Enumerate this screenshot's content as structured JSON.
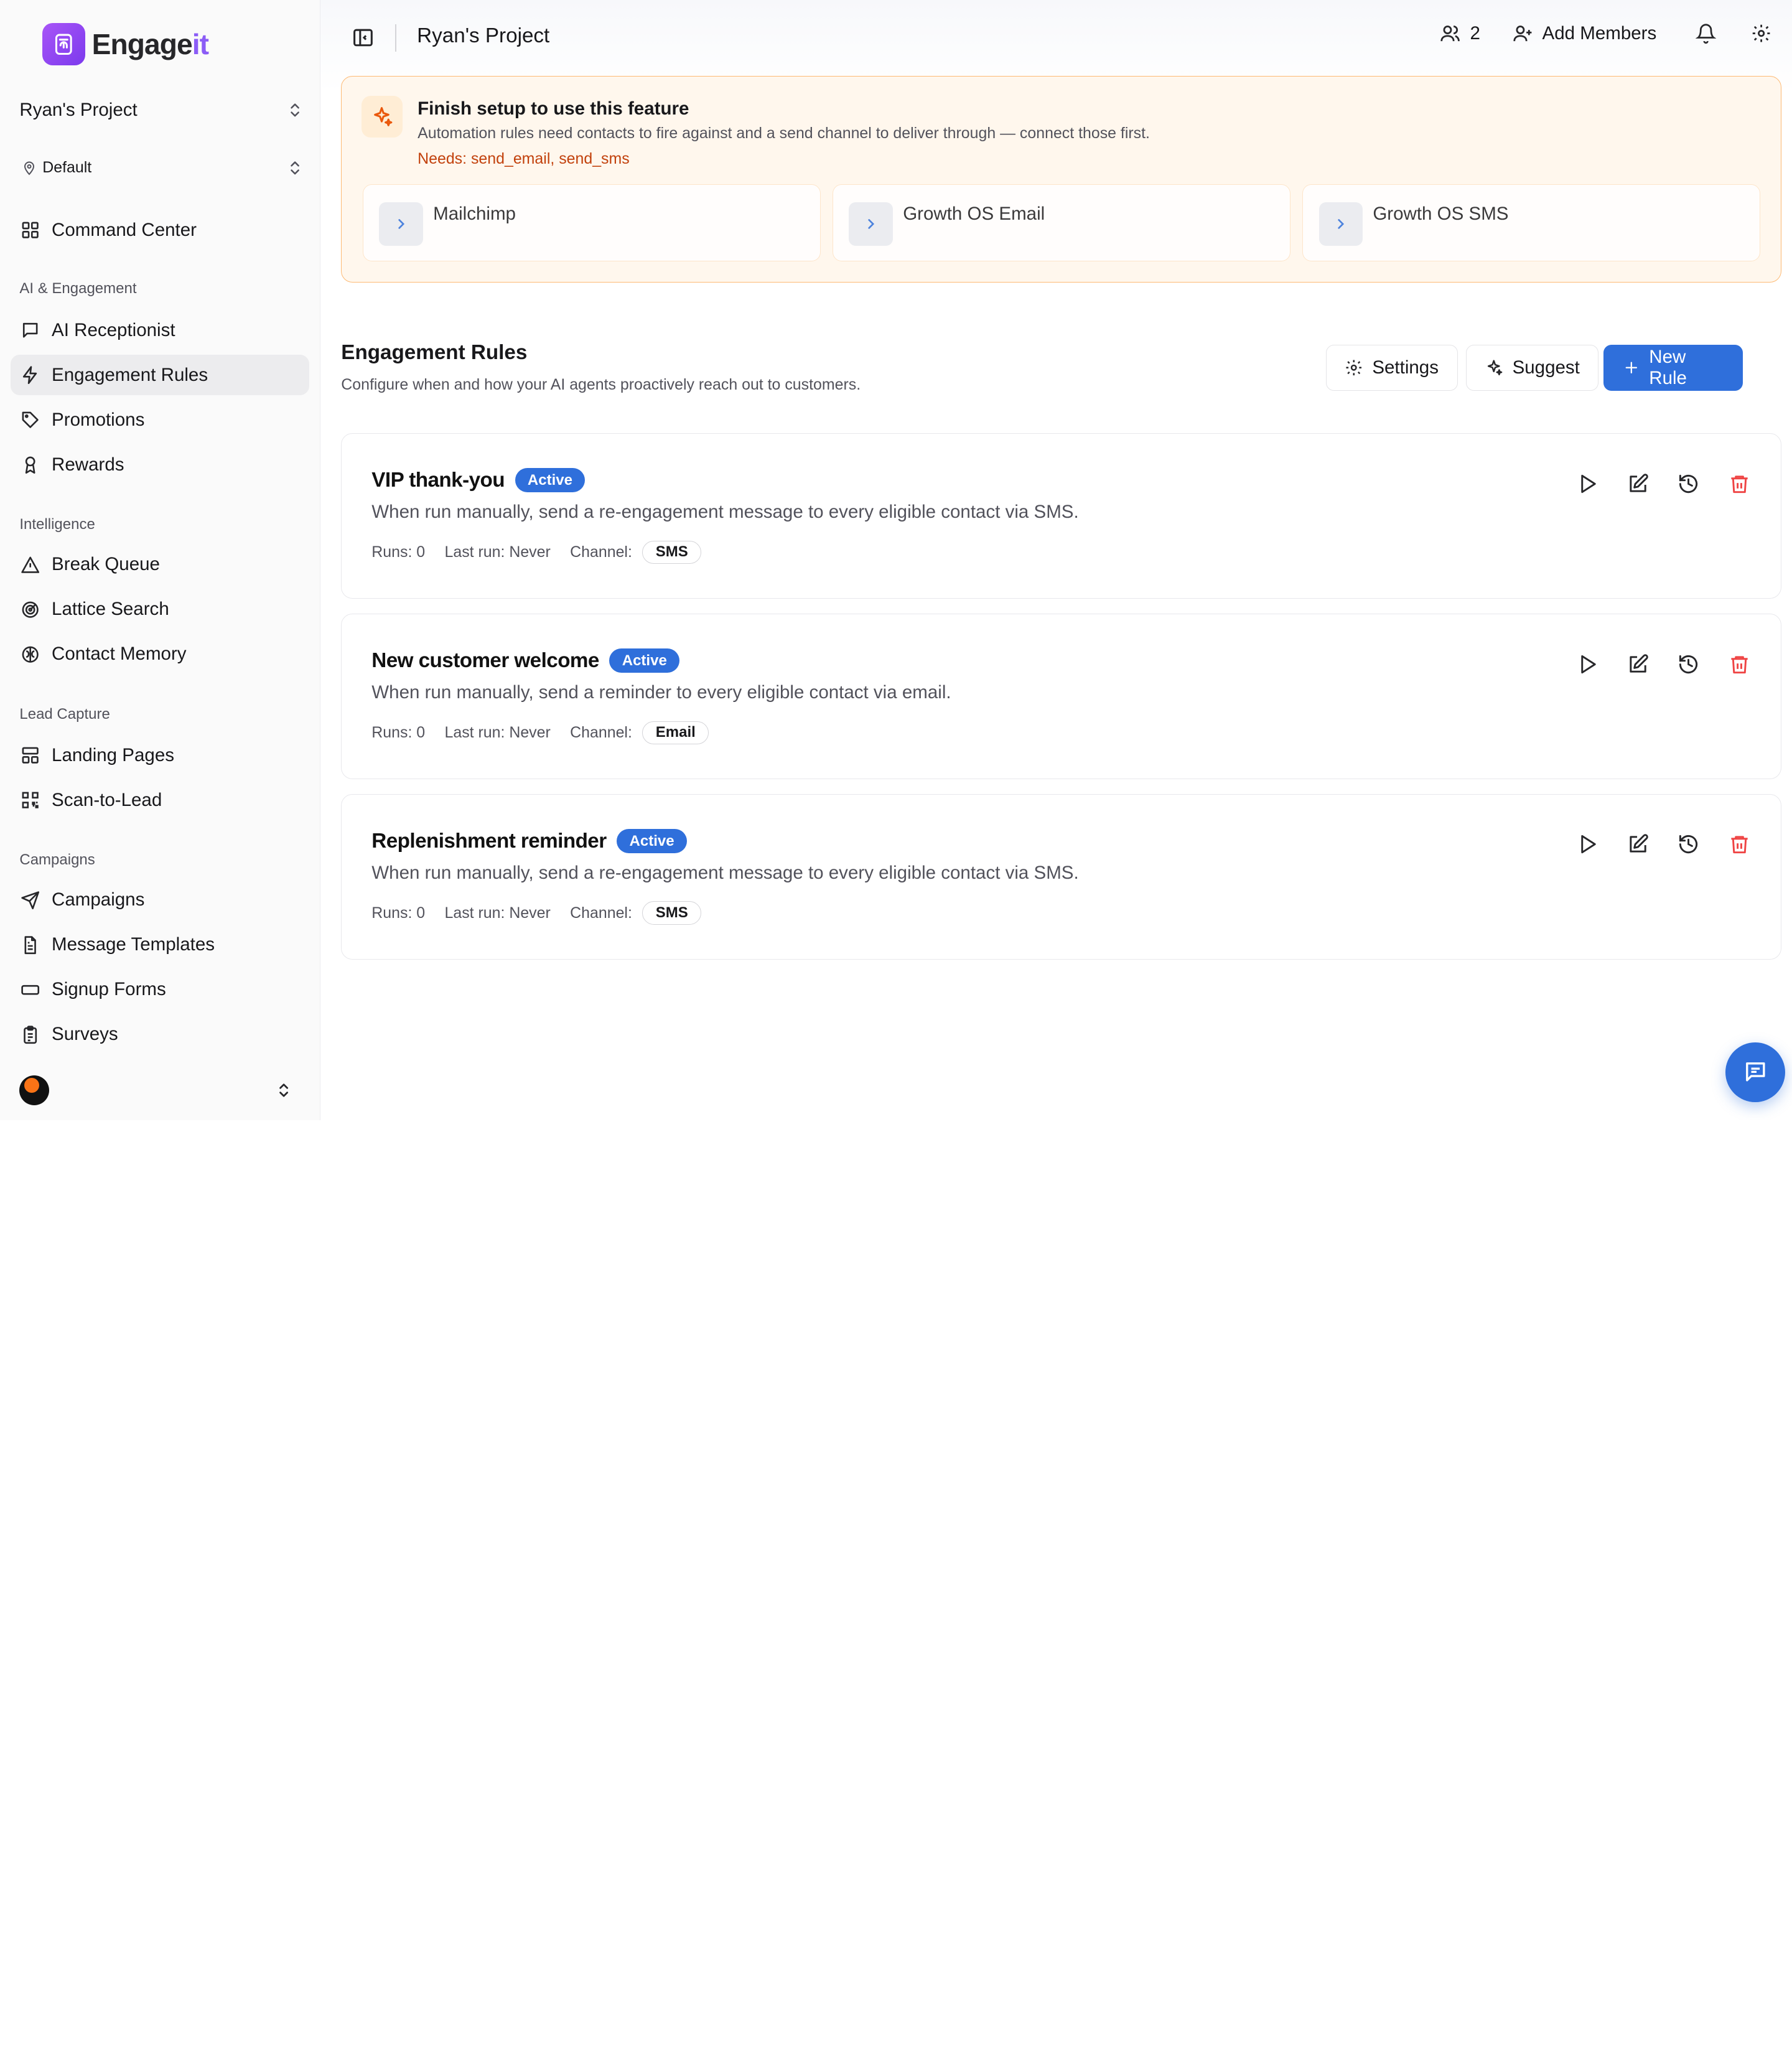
{
  "brand": {
    "name_main": "Engage",
    "name_highlight": "it"
  },
  "sidebar": {
    "project": "Ryan's Project",
    "environment": "Default",
    "top_item": "Command Center",
    "sections": [
      {
        "label": "AI & Engagement",
        "items": [
          "AI Receptionist",
          "Engagement Rules",
          "Promotions",
          "Rewards"
        ]
      },
      {
        "label": "Intelligence",
        "items": [
          "Break Queue",
          "Lattice Search",
          "Contact Memory"
        ]
      },
      {
        "label": "Lead Capture",
        "items": [
          "Landing Pages",
          "Scan-to-Lead"
        ]
      },
      {
        "label": "Campaigns",
        "items": [
          "Campaigns",
          "Message Templates",
          "Signup Forms",
          "Surveys"
        ]
      }
    ],
    "active_item": "Engagement Rules"
  },
  "header": {
    "title": "Ryan's Project",
    "member_count": "2",
    "add_members": "Add Members"
  },
  "setup_banner": {
    "title": "Finish setup to use this feature",
    "description": "Automation rules need contacts to fire against and a send channel to deliver through — connect those first.",
    "needs": "Needs: send_email, send_sms",
    "connectors": [
      "Mailchimp",
      "Growth OS Email",
      "Growth OS SMS"
    ]
  },
  "rules_page": {
    "title": "Engagement Rules",
    "subtitle": "Configure when and how your AI agents proactively reach out to customers.",
    "settings_label": "Settings",
    "suggest_label": "Suggest",
    "new_rule_label": "New Rule"
  },
  "rules": [
    {
      "name": "VIP thank-you",
      "status": "Active",
      "description": "When run manually, send a re-engagement message to every eligible contact via SMS.",
      "runs": "Runs: 0",
      "last_run": "Last run: Never",
      "channel_label": "Channel:",
      "channel": "SMS"
    },
    {
      "name": "New customer welcome",
      "status": "Active",
      "description": "When run manually, send a reminder to every eligible contact via email.",
      "runs": "Runs: 0",
      "last_run": "Last run: Never",
      "channel_label": "Channel:",
      "channel": "Email"
    },
    {
      "name": "Replenishment reminder",
      "status": "Active",
      "description": "When run manually, send a re-engagement message to every eligible contact via SMS.",
      "runs": "Runs: 0",
      "last_run": "Last run: Never",
      "channel_label": "Channel:",
      "channel": "SMS"
    }
  ],
  "colors": {
    "primary": "#2f6fdb",
    "brand": "#8b5cf6",
    "warning_bg": "#fff7ed",
    "warning_border": "#fdba74",
    "danger": "#ef4444"
  }
}
